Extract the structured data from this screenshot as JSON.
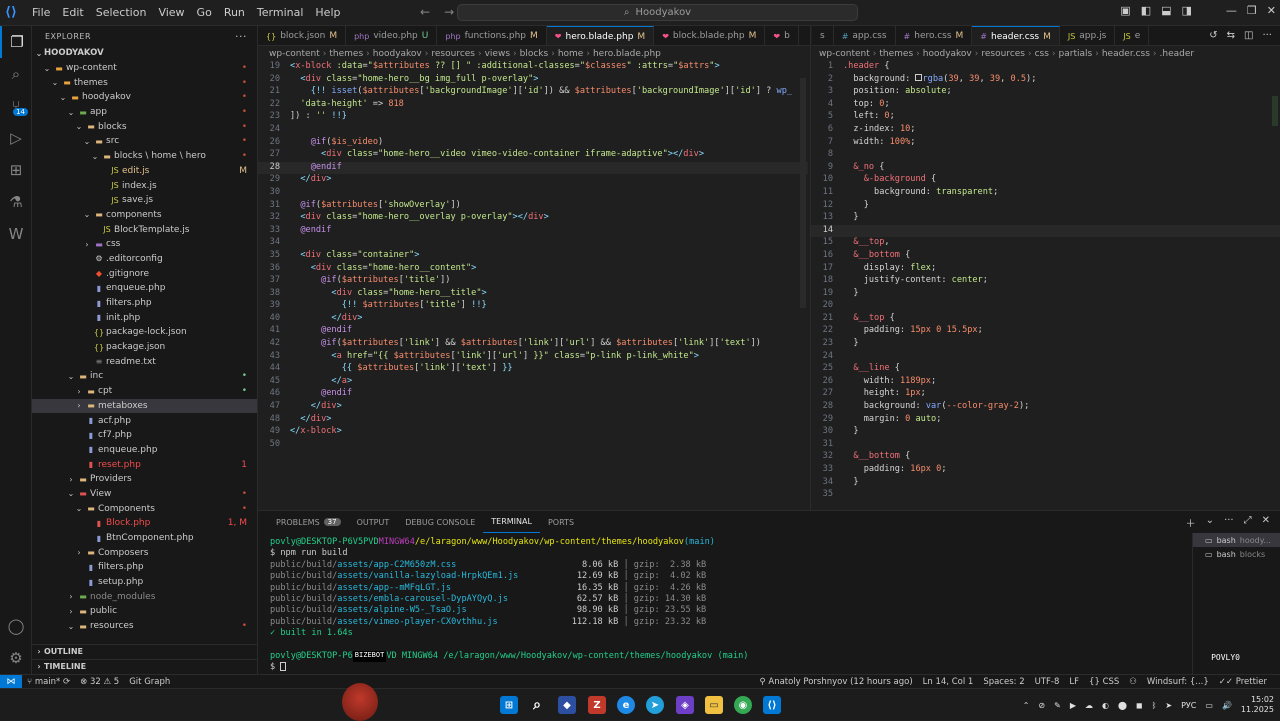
{
  "window": {
    "menu": [
      "File",
      "Edit",
      "Selection",
      "View",
      "Go",
      "Run",
      "Terminal",
      "Help"
    ],
    "search": "Hoodyakov"
  },
  "activity": {
    "scm_badge": "14"
  },
  "explorer": {
    "title": "EXPLORER",
    "root": "HOODYAKOV",
    "items": [
      {
        "label": "wp-content",
        "depth": 1,
        "type": "folder-orange",
        "open": true,
        "status": "•",
        "scolor": "#c74e39"
      },
      {
        "label": "themes",
        "depth": 2,
        "type": "folder-orange",
        "open": true,
        "status": "•",
        "scolor": "#c74e39"
      },
      {
        "label": "hoodyakov",
        "depth": 3,
        "type": "folder-orange",
        "open": true,
        "status": "•",
        "scolor": "#c74e39"
      },
      {
        "label": "app",
        "depth": 4,
        "type": "folder-green",
        "open": true,
        "status": "•",
        "scolor": "#c74e39"
      },
      {
        "label": "blocks",
        "depth": 5,
        "type": "folder",
        "open": true,
        "status": "•",
        "scolor": "#c74e39"
      },
      {
        "label": "src",
        "depth": 6,
        "type": "folder",
        "open": true,
        "status": "•",
        "scolor": "#c74e39"
      },
      {
        "label": "blocks \\ home \\ hero",
        "depth": 7,
        "type": "folder",
        "open": true,
        "status": "•",
        "scolor": "#c74e39"
      },
      {
        "label": "edit.js",
        "depth": 8,
        "type": "js",
        "status": "M",
        "scolor": "#e2c08d"
      },
      {
        "label": "index.js",
        "depth": 8,
        "type": "js",
        "status": "",
        "scolor": ""
      },
      {
        "label": "save.js",
        "depth": 8,
        "type": "js",
        "status": "",
        "scolor": ""
      },
      {
        "label": "components",
        "depth": 6,
        "type": "folder",
        "open": true,
        "status": "",
        "scolor": ""
      },
      {
        "label": "BlockTemplate.js",
        "depth": 7,
        "type": "js",
        "status": "",
        "scolor": ""
      },
      {
        "label": "css",
        "depth": 6,
        "type": "folder-purple",
        "open": false,
        "status": "",
        "scolor": ""
      },
      {
        "label": ".editorconfig",
        "depth": 6,
        "type": "cfg",
        "status": "",
        "scolor": ""
      },
      {
        "label": ".gitignore",
        "depth": 6,
        "type": "git",
        "status": "",
        "scolor": ""
      },
      {
        "label": "enqueue.php",
        "depth": 6,
        "type": "php",
        "status": "",
        "scolor": ""
      },
      {
        "label": "filters.php",
        "depth": 6,
        "type": "php",
        "status": "",
        "scolor": ""
      },
      {
        "label": "init.php",
        "depth": 6,
        "type": "php",
        "status": "",
        "scolor": ""
      },
      {
        "label": "package-lock.json",
        "depth": 6,
        "type": "json",
        "status": "",
        "scolor": ""
      },
      {
        "label": "package.json",
        "depth": 6,
        "type": "json",
        "status": "",
        "scolor": ""
      },
      {
        "label": "readme.txt",
        "depth": 6,
        "type": "txt",
        "status": "",
        "scolor": ""
      },
      {
        "label": "inc",
        "depth": 4,
        "type": "folder",
        "open": true,
        "status": "•",
        "scolor": "#73c991"
      },
      {
        "label": "cpt",
        "depth": 5,
        "type": "folder",
        "open": false,
        "status": "•",
        "scolor": "#73c991"
      },
      {
        "label": "metaboxes",
        "depth": 5,
        "type": "folder",
        "open": false,
        "status": "",
        "scolor": "",
        "sel": true
      },
      {
        "label": "acf.php",
        "depth": 5,
        "type": "php",
        "status": "",
        "scolor": ""
      },
      {
        "label": "cf7.php",
        "depth": 5,
        "type": "php",
        "status": "",
        "scolor": ""
      },
      {
        "label": "enqueue.php",
        "depth": 5,
        "type": "php",
        "status": "",
        "scolor": ""
      },
      {
        "label": "reset.php",
        "depth": 5,
        "type": "php-red",
        "status": "1",
        "scolor": "#f14c4c"
      },
      {
        "label": "Providers",
        "depth": 4,
        "type": "folder",
        "open": false,
        "status": "",
        "scolor": ""
      },
      {
        "label": "View",
        "depth": 4,
        "type": "folder-red",
        "open": true,
        "status": "•",
        "scolor": "#c74e39"
      },
      {
        "label": "Components",
        "depth": 5,
        "type": "folder",
        "open": true,
        "status": "•",
        "scolor": "#c74e39"
      },
      {
        "label": "Block.php",
        "depth": 6,
        "type": "php-red",
        "status": "1, M",
        "scolor": "#f14c4c"
      },
      {
        "label": "BtnComponent.php",
        "depth": 6,
        "type": "php",
        "status": "",
        "scolor": ""
      },
      {
        "label": "Composers",
        "depth": 5,
        "type": "folder",
        "open": false,
        "status": "",
        "scolor": ""
      },
      {
        "label": "filters.php",
        "depth": 5,
        "type": "php",
        "status": "",
        "scolor": ""
      },
      {
        "label": "setup.php",
        "depth": 5,
        "type": "php",
        "status": "",
        "scolor": ""
      },
      {
        "label": "node_modules",
        "depth": 4,
        "type": "folder-green",
        "open": false,
        "status": "",
        "scolor": "",
        "dim": true
      },
      {
        "label": "public",
        "depth": 4,
        "type": "folder",
        "open": false,
        "status": "",
        "scolor": ""
      },
      {
        "label": "resources",
        "depth": 4,
        "type": "folder",
        "open": true,
        "status": "•",
        "scolor": "#c74e39"
      }
    ],
    "outline": "OUTLINE",
    "timeline": "TIMELINE"
  },
  "tabs_left": [
    {
      "label": "block.json",
      "flag": "M",
      "icon": "{}",
      "color": "#cbcb41"
    },
    {
      "label": "video.php",
      "flag": "U",
      "icon": "php",
      "color": "#a074c4"
    },
    {
      "label": "functions.php",
      "flag": "M",
      "icon": "php",
      "color": "#a074c4"
    },
    {
      "label": "hero.blade.php",
      "flag": "M",
      "icon": "❤",
      "color": "#f55385",
      "active": true
    },
    {
      "label": "block.blade.php",
      "flag": "M",
      "icon": "❤",
      "color": "#f55385"
    },
    {
      "label": "b",
      "flag": "",
      "icon": "❤",
      "color": "#f55385"
    }
  ],
  "tabs_right": [
    {
      "label": "s",
      "flag": "",
      "icon": "",
      "color": "#519aba"
    },
    {
      "label": "app.css",
      "flag": "",
      "icon": "#",
      "color": "#519aba"
    },
    {
      "label": "hero.css",
      "flag": "M",
      "icon": "#",
      "color": "#a074c4"
    },
    {
      "label": "header.css",
      "flag": "M",
      "icon": "#",
      "color": "#a074c4",
      "active": true
    },
    {
      "label": "app.js",
      "flag": "",
      "icon": "JS",
      "color": "#cbcb41"
    },
    {
      "label": "e",
      "flag": "",
      "icon": "JS",
      "color": "#cbcb41"
    }
  ],
  "breadcrumb_left": [
    "wp-content",
    "themes",
    "hoodyakov",
    "resources",
    "views",
    "blocks",
    "home",
    "hero.blade.php"
  ],
  "breadcrumb_right": [
    "wp-content",
    "themes",
    "hoodyakov",
    "resources",
    "css",
    "partials",
    "header.css",
    ".header"
  ],
  "editor_left": [
    {
      "n": "19",
      "h": "<span class=\"k-pun\">&lt;</span><span class=\"k-tag\">x-block</span> <span class=\"k-attr\">:data</span>=<span class=\"k-str\">\"</span><span class=\"k-var\">$attributes</span><span class=\"k-str\"> ?? [] \"</span> <span class=\"k-attr\">:additional-classes</span>=<span class=\"k-str\">\"</span><span class=\"k-var\">$classes</span><span class=\"k-str\">\"</span> <span class=\"k-attr\">:attrs</span>=<span class=\"k-str\">\"</span><span class=\"k-var\">$attrs</span><span class=\"k-str\">\"</span><span class=\"k-pun\">&gt;</span>"
    },
    {
      "n": "20",
      "h": "  <span class=\"k-pun\">&lt;</span><span class=\"k-tag\">div</span> <span class=\"k-attr\">class</span>=<span class=\"k-str\">\"home-hero__bg img_full p-overlay\"</span><span class=\"k-pun\">&gt;</span>"
    },
    {
      "n": "21",
      "h": "    <span class=\"k-pun\">{!!</span> <span class=\"k-fn\">isset</span>(<span class=\"k-var\">$attributes</span>[<span class=\"k-str\">'backgroundImage'</span>][<span class=\"k-str\">'id'</span>]) &amp;&amp; <span class=\"k-var\">$attributes</span>[<span class=\"k-str\">'backgroundImage'</span>][<span class=\"k-str\">'id'</span>] ? <span class=\"k-fn\">wp_</span>"
    },
    {
      "n": "22",
      "h": "  <span class=\"k-str\">'data-height'</span> =&gt; <span class=\"k-num\">818</span>"
    },
    {
      "n": "23",
      "h": "]) : <span class=\"k-str\">''</span> <span class=\"k-pun\">!!}</span>"
    },
    {
      "n": "24",
      "h": ""
    },
    {
      "n": "26",
      "h": "    <span class=\"k-dir\">@if</span>(<span class=\"k-var\">$is_video</span>)"
    },
    {
      "n": "27",
      "h": "      <span class=\"k-pun\">&lt;</span><span class=\"k-tag\">div</span> <span class=\"k-attr\">class</span>=<span class=\"k-str\">\"home-hero__video vimeo-video-container iframe-adaptive\"</span><span class=\"k-pun\">&gt;&lt;/</span><span class=\"k-tag\">div</span><span class=\"k-pun\">&gt;</span>"
    },
    {
      "n": "28",
      "h": "    <span class=\"k-dir\">@endif</span>",
      "cur": true
    },
    {
      "n": "29",
      "h": "  <span class=\"k-pun\">&lt;/</span><span class=\"k-tag\">div</span><span class=\"k-pun\">&gt;</span>"
    },
    {
      "n": "30",
      "h": ""
    },
    {
      "n": "31",
      "h": "  <span class=\"k-dir\">@if</span>(<span class=\"k-var\">$attributes</span>[<span class=\"k-str\">'showOverlay'</span>])"
    },
    {
      "n": "32",
      "h": "  <span class=\"k-pun\">&lt;</span><span class=\"k-tag\">div</span> <span class=\"k-attr\">class</span>=<span class=\"k-str\">\"home-hero__overlay p-overlay\"</span><span class=\"k-pun\">&gt;&lt;/</span><span class=\"k-tag\">div</span><span class=\"k-pun\">&gt;</span>"
    },
    {
      "n": "33",
      "h": "  <span class=\"k-dir\">@endif</span>"
    },
    {
      "n": "34",
      "h": ""
    },
    {
      "n": "35",
      "h": "  <span class=\"k-pun\">&lt;</span><span class=\"k-tag\">div</span> <span class=\"k-attr\">class</span>=<span class=\"k-str\">\"container\"</span><span class=\"k-pun\">&gt;</span>"
    },
    {
      "n": "36",
      "h": "    <span class=\"k-pun\">&lt;</span><span class=\"k-tag\">div</span> <span class=\"k-attr\">class</span>=<span class=\"k-str\">\"home-hero__content\"</span><span class=\"k-pun\">&gt;</span>"
    },
    {
      "n": "37",
      "h": "      <span class=\"k-dir\">@if</span>(<span class=\"k-var\">$attributes</span>[<span class=\"k-str\">'title'</span>])"
    },
    {
      "n": "38",
      "h": "        <span class=\"k-pun\">&lt;</span><span class=\"k-tag\">div</span> <span class=\"k-attr\">class</span>=<span class=\"k-str\">\"home-hero__title\"</span><span class=\"k-pun\">&gt;</span>"
    },
    {
      "n": "39",
      "h": "          <span class=\"k-pun\">{!!</span> <span class=\"k-var\">$attributes</span>[<span class=\"k-str\">'title'</span>] <span class=\"k-pun\">!!}</span>"
    },
    {
      "n": "40",
      "h": "        <span class=\"k-pun\">&lt;/</span><span class=\"k-tag\">div</span><span class=\"k-pun\">&gt;</span>"
    },
    {
      "n": "41",
      "h": "      <span class=\"k-dir\">@endif</span>"
    },
    {
      "n": "42",
      "h": "      <span class=\"k-dir\">@if</span>(<span class=\"k-var\">$attributes</span>[<span class=\"k-str\">'link'</span>] &amp;&amp; <span class=\"k-var\">$attributes</span>[<span class=\"k-str\">'link'</span>][<span class=\"k-str\">'url'</span>] &amp;&amp; <span class=\"k-var\">$attributes</span>[<span class=\"k-str\">'link'</span>][<span class=\"k-str\">'text'</span>])"
    },
    {
      "n": "43",
      "h": "        <span class=\"k-pun\">&lt;</span><span class=\"k-tag\">a</span> <span class=\"k-attr\">href</span>=<span class=\"k-str\">\"{{ </span><span class=\"k-var\">$attributes</span>[<span class=\"k-str\">'link'</span>][<span class=\"k-str\">'url'</span>] <span class=\"k-str\">}}\"</span> <span class=\"k-attr\">class</span>=<span class=\"k-str\">\"p-link p-link_white\"</span><span class=\"k-pun\">&gt;</span>"
    },
    {
      "n": "44",
      "h": "          <span class=\"k-pun\">{{</span> <span class=\"k-var\">$attributes</span>[<span class=\"k-str\">'link'</span>][<span class=\"k-str\">'text'</span>] <span class=\"k-pun\">}}</span>"
    },
    {
      "n": "45",
      "h": "        <span class=\"k-pun\">&lt;/</span><span class=\"k-tag\">a</span><span class=\"k-pun\">&gt;</span>"
    },
    {
      "n": "46",
      "h": "      <span class=\"k-dir\">@endif</span>"
    },
    {
      "n": "47",
      "h": "    <span class=\"k-pun\">&lt;/</span><span class=\"k-tag\">div</span><span class=\"k-pun\">&gt;</span>"
    },
    {
      "n": "48",
      "h": "  <span class=\"k-pun\">&lt;/</span><span class=\"k-tag\">div</span><span class=\"k-pun\">&gt;</span>"
    },
    {
      "n": "49",
      "h": "<span class=\"k-pun\">&lt;/</span><span class=\"k-tag\">x-block</span><span class=\"k-pun\">&gt;</span>"
    },
    {
      "n": "50",
      "h": ""
    }
  ],
  "editor_right": [
    {
      "n": "1",
      "h": "<span class=\"k-sel\">.header</span> {"
    },
    {
      "n": "2",
      "h": "  <span class=\"k-prop\">background</span>: <span style=\"border:1px solid #ccc;display:inline-block;width:7px;height:7px\"></span><span class=\"k-fn\">rgba</span>(<span class=\"k-num\">39</span>, <span class=\"k-num\">39</span>, <span class=\"k-num\">39</span>, <span class=\"k-num\">0.5</span>);"
    },
    {
      "n": "3",
      "h": "  <span class=\"k-prop\">position</span>: <span class=\"k-str\">absolute</span>;"
    },
    {
      "n": "4",
      "h": "  <span class=\"k-prop\">top</span>: <span class=\"k-num\">0</span>;"
    },
    {
      "n": "5",
      "h": "  <span class=\"k-prop\">left</span>: <span class=\"k-num\">0</span>;"
    },
    {
      "n": "6",
      "h": "  <span class=\"k-prop\">z-index</span>: <span class=\"k-num\">10</span>;"
    },
    {
      "n": "7",
      "h": "  <span class=\"k-prop\">width</span>: <span class=\"k-num\">100%</span>;"
    },
    {
      "n": "8",
      "h": ""
    },
    {
      "n": "9",
      "h": "  <span class=\"k-sel\">&amp;_no</span> {"
    },
    {
      "n": "10",
      "h": "    <span class=\"k-sel\">&amp;-background</span> {"
    },
    {
      "n": "11",
      "h": "      <span class=\"k-prop\">background</span>: <span class=\"k-str\">transparent</span>;"
    },
    {
      "n": "12",
      "h": "    }"
    },
    {
      "n": "13",
      "h": "  }"
    },
    {
      "n": "14",
      "h": "",
      "cur": true
    },
    {
      "n": "15",
      "h": "  <span class=\"k-sel\">&amp;__top</span>,"
    },
    {
      "n": "16",
      "h": "  <span class=\"k-sel\">&amp;__bottom</span> {"
    },
    {
      "n": "17",
      "h": "    <span class=\"k-prop\">display</span>: <span class=\"k-str\">flex</span>;"
    },
    {
      "n": "18",
      "h": "    <span class=\"k-prop\">justify-content</span>: <span class=\"k-str\">center</span>;"
    },
    {
      "n": "19",
      "h": "  }"
    },
    {
      "n": "20",
      "h": ""
    },
    {
      "n": "21",
      "h": "  <span class=\"k-sel\">&amp;__top</span> {"
    },
    {
      "n": "22",
      "h": "    <span class=\"k-prop\">padding</span>: <span class=\"k-num\">15px</span> <span class=\"k-num\">0</span> <span class=\"k-num\">15.5px</span>;"
    },
    {
      "n": "23",
      "h": "  }"
    },
    {
      "n": "24",
      "h": ""
    },
    {
      "n": "25",
      "h": "  <span class=\"k-sel\">&amp;__line</span> {"
    },
    {
      "n": "26",
      "h": "    <span class=\"k-prop\">width</span>: <span class=\"k-num\">1189px</span>;"
    },
    {
      "n": "27",
      "h": "    <span class=\"k-prop\">height</span>: <span class=\"k-num\">1px</span>;"
    },
    {
      "n": "28",
      "h": "    <span class=\"k-prop\">background</span>: <span class=\"k-fn\">var</span>(<span class=\"k-var\">--color-gray-2</span>);"
    },
    {
      "n": "29",
      "h": "    <span class=\"k-prop\">margin</span>: <span class=\"k-num\">0</span> <span class=\"k-str\">auto</span>;"
    },
    {
      "n": "30",
      "h": "  }"
    },
    {
      "n": "31",
      "h": ""
    },
    {
      "n": "32",
      "h": "  <span class=\"k-sel\">&amp;__bottom</span> {"
    },
    {
      "n": "33",
      "h": "    <span class=\"k-prop\">padding</span>: <span class=\"k-num\">16px</span> <span class=\"k-num\">0</span>;"
    },
    {
      "n": "34",
      "h": "  }"
    },
    {
      "n": "35",
      "h": ""
    }
  ],
  "panel": {
    "tabs": [
      {
        "label": "PROBLEMS",
        "badge": "37"
      },
      {
        "label": "OUTPUT"
      },
      {
        "label": "DEBUG CONSOLE"
      },
      {
        "label": "TERMINAL",
        "active": true
      },
      {
        "label": "PORTS"
      }
    ],
    "prompt_user": "povly@DESKTOP-P6V5PVD",
    "prompt_env": "MINGW64",
    "prompt_path": "/e/laragon/www/Hoodyakov/wp-content/themes/hoodyakov",
    "prompt_branch": "(main)",
    "command": "$ npm run build",
    "build": [
      {
        "dir": "public/build/",
        "file": "assets/app-C2M650zM.css",
        "size": "8.06 kB",
        "gzip": "gzip:  2.38 kB"
      },
      {
        "dir": "public/build/",
        "file": "assets/vanilla-lazyload-HrpkQEm1.js",
        "size": "12.69 kB",
        "gzip": "gzip:  4.02 kB"
      },
      {
        "dir": "public/build/",
        "file": "assets/app--mMFqLGT.js",
        "size": "16.35 kB",
        "gzip": "gzip:  4.26 kB"
      },
      {
        "dir": "public/build/",
        "file": "assets/embla-carousel-DypAYQyQ.js",
        "size": "62.57 kB",
        "gzip": "gzip: 14.30 kB"
      },
      {
        "dir": "public/build/",
        "file": "assets/alpine-W5-_TsaO.js",
        "size": "98.90 kB",
        "gzip": "gzip: 23.55 kB"
      },
      {
        "dir": "public/build/",
        "file": "assets/vimeo-player-CX0vthhu.js",
        "size": "112.18 kB",
        "gzip": "gzip: 23.32 kB"
      }
    ],
    "built": "✓ built in 1.64s",
    "prompt2_user": "povly@DESKTOP-P6",
    "prompt2_tag": "BIZEBOT",
    "prompt2_tail": "VD MINGW64 /e/laragon/www/Hoodyakov/wp-content/themes/hoodyakov (main)",
    "cursor_line": "$ ",
    "shells": [
      {
        "name": "bash",
        "sub": "hoody...",
        "sel": true
      },
      {
        "name": "bash",
        "sub": "blocks"
      }
    ],
    "overlay_name": "POVLY0"
  },
  "status": {
    "branch": "main*",
    "sync": "",
    "problems": "⊗ 32 ⚠ 5",
    "gitgraph": "Git Graph",
    "author": "Anatoly Porshnyov (12 hours ago)",
    "position": "Ln 14, Col 1",
    "spaces": "Spaces: 2",
    "encoding": "UTF-8",
    "eol": "LF",
    "lang": "CSS",
    "windsurf": "Windsurf: {...}",
    "prettier": "Prettier"
  },
  "taskbar": {
    "lang": "РУС",
    "time": "15:02",
    "date": "11.2025"
  },
  "colors": {
    "accent": "#0078d4",
    "modified": "#e2c08d",
    "untracked": "#73c991",
    "error": "#f14c4c"
  }
}
